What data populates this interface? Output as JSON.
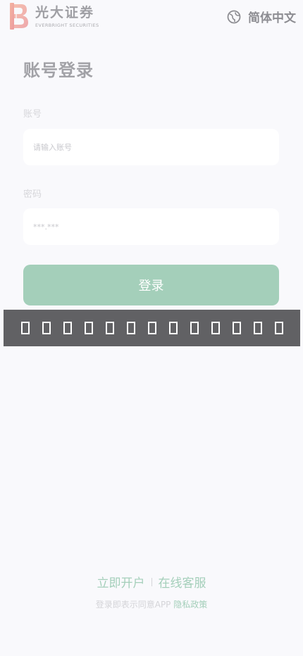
{
  "header": {
    "logo_cn": "光大证券",
    "logo_en": "EVERBRIGHT SECURITIES",
    "language_label": "简体中文"
  },
  "login": {
    "title": "账号登录",
    "account_label": "账号",
    "account_placeholder": "请输入账号",
    "password_label": "密码",
    "password_placeholder": "***.***",
    "submit_label": "登录"
  },
  "toast": {
    "glyph_count": 13
  },
  "footer": {
    "open_account": "立即开户",
    "customer_service": "在线客服",
    "agreement_text": "登录即表示同意APP",
    "privacy_policy": "隐私政策"
  },
  "colors": {
    "accent": "#a4cfba",
    "background": "#f9f9fc",
    "overlay": "#616164"
  }
}
